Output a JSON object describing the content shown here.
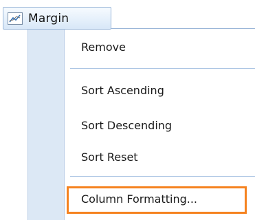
{
  "header": {
    "icon": "line-chart-icon",
    "label": "Margin"
  },
  "menu": {
    "items": [
      {
        "label": "Remove"
      },
      {
        "label": "Sort Ascending"
      },
      {
        "label": "Sort Descending"
      },
      {
        "label": "Sort Reset"
      },
      {
        "label": "Column Formatting..."
      }
    ]
  },
  "colors": {
    "highlight": "#f5821f",
    "gutter": "#dce8f5",
    "separator": "#a9c3e3"
  }
}
